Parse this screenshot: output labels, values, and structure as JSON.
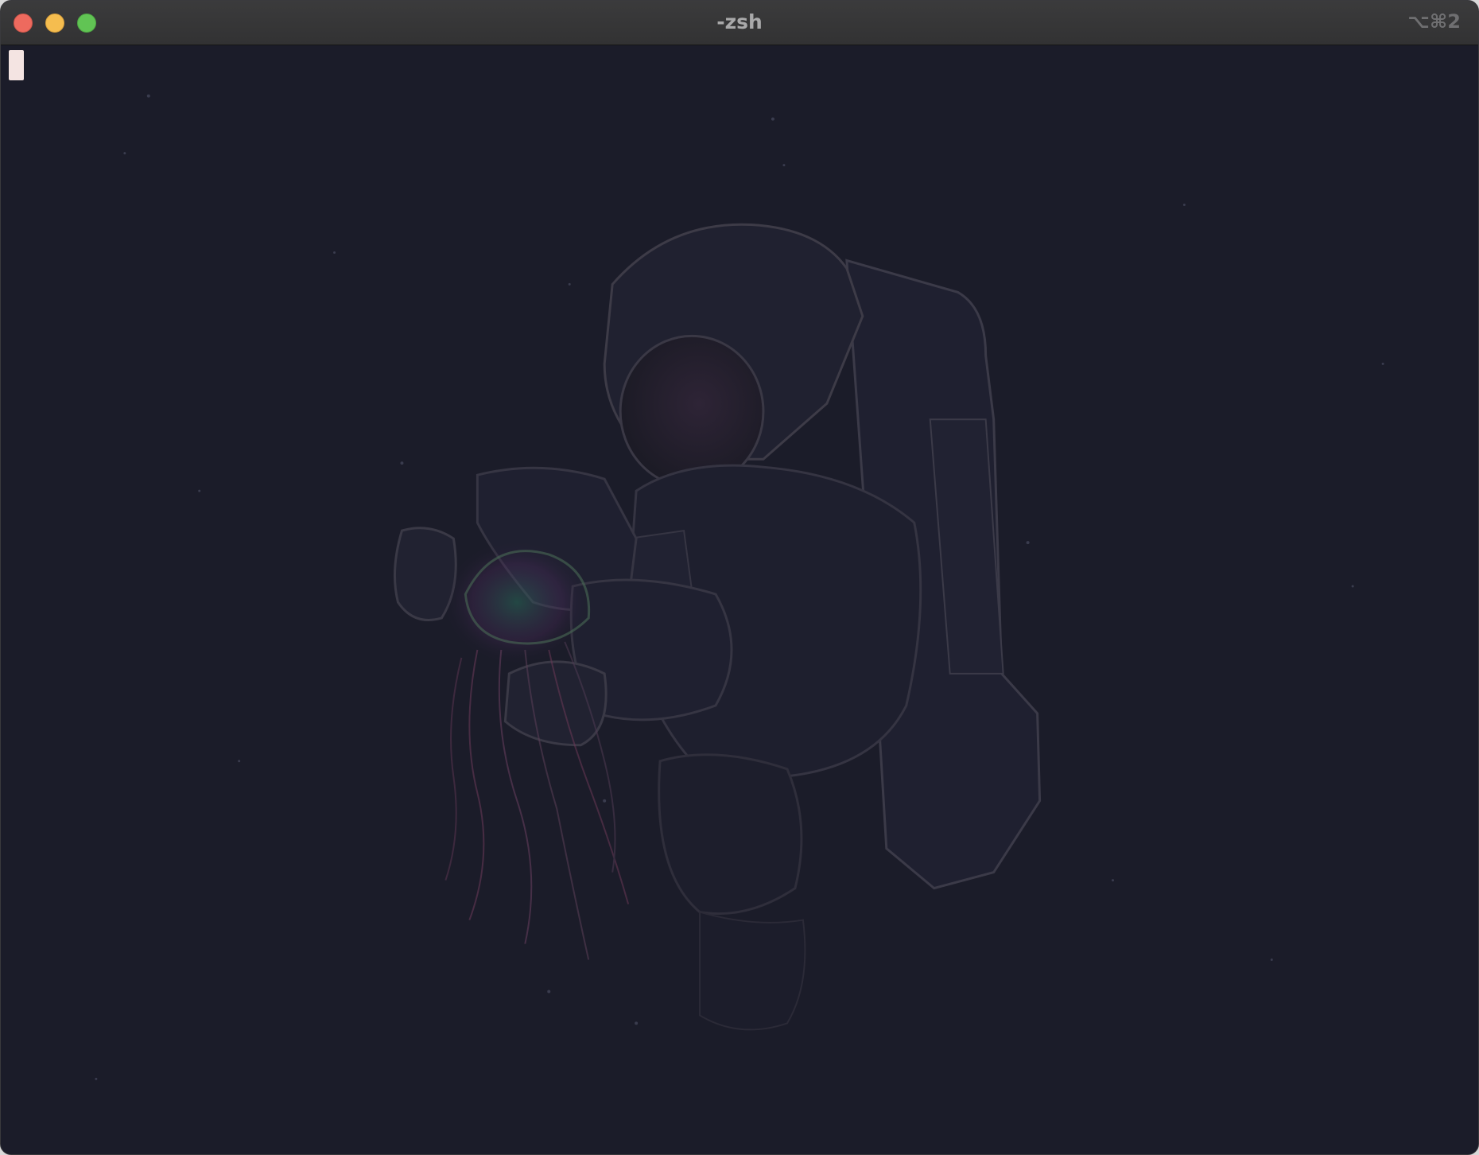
{
  "window": {
    "title": "-zsh",
    "tab_shortcut": "⌥⌘2"
  },
  "traffic_lights": {
    "close_color": "#ee6a5e",
    "minimize_color": "#f5bd4f",
    "zoom_color": "#61c454"
  },
  "terminal": {
    "background_color": "#1b1c29",
    "cursor_color": "#f4e4e2",
    "background_image": "astronaut-holding-jellyfish"
  }
}
